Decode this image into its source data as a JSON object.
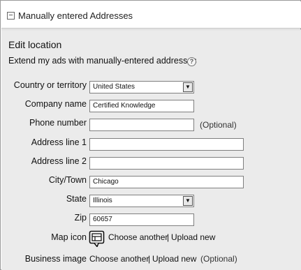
{
  "header": {
    "toggle": "−",
    "title": "Manually entered Addresses"
  },
  "panel": {
    "heading": "Edit location",
    "extend_text": "Extend my ads with manually-entered addresses",
    "help": "?"
  },
  "fields": {
    "country": {
      "label": "Country or territory",
      "value": "United States"
    },
    "company": {
      "label": "Company name",
      "value": "Certified Knowledge"
    },
    "phone": {
      "label": "Phone number",
      "value": "",
      "optional": "(Optional)"
    },
    "address1": {
      "label": "Address line 1",
      "value": ""
    },
    "address2": {
      "label": "Address line 2",
      "value": ""
    },
    "city": {
      "label": "City/Town",
      "value": "Chicago"
    },
    "state": {
      "label": "State",
      "value": "Illinois"
    },
    "zip": {
      "label": "Zip",
      "value": "60657"
    }
  },
  "map_icon": {
    "label": "Map icon",
    "choose": "Choose another",
    "separator": "|",
    "upload": "Upload new"
  },
  "business_image": {
    "label": "Business image",
    "choose": "Choose another",
    "separator": "|",
    "upload": "Upload new",
    "optional": "(Optional)"
  },
  "icons": {
    "collapse": "minus-box-icon",
    "help": "question-circle-icon",
    "map": "map-pin-icon",
    "dropdown": "dropdown-arrow-icon"
  }
}
